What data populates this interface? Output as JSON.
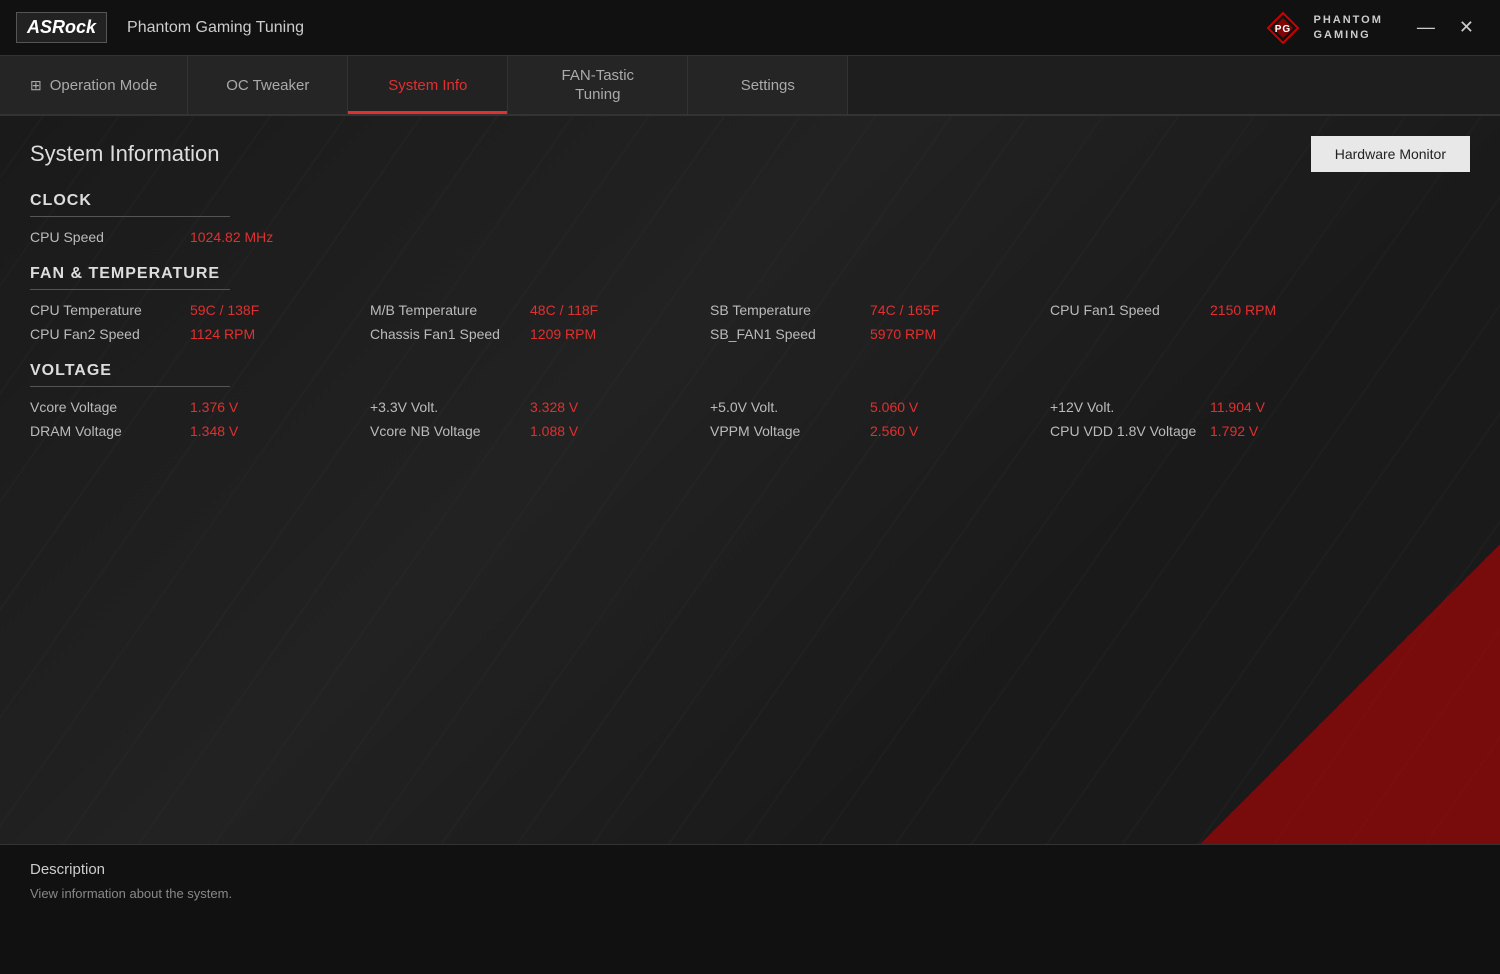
{
  "titlebar": {
    "logo": "ASRock",
    "app_title": "Phantom Gaming Tuning",
    "phantom_label": "PHANTOM\nGAMING",
    "minimize_label": "—",
    "close_label": "✕"
  },
  "nav": {
    "tabs": [
      {
        "id": "operation-mode",
        "label": "Operation Mode",
        "icon": "grid",
        "active": false
      },
      {
        "id": "oc-tweaker",
        "label": "OC Tweaker",
        "active": false
      },
      {
        "id": "system-info",
        "label": "System Info",
        "active": true
      },
      {
        "id": "fan-tastic",
        "label": "FAN-Tastic\nTuning",
        "active": false
      },
      {
        "id": "settings",
        "label": "Settings",
        "active": false
      }
    ]
  },
  "section": {
    "title": "System Information",
    "hardware_monitor_btn": "Hardware Monitor"
  },
  "clock": {
    "section_label": "CLOCK",
    "items": [
      {
        "label": "CPU Speed",
        "value": "1024.82 MHz"
      }
    ]
  },
  "fan_temperature": {
    "section_label": "FAN & TEMPERATURE",
    "rows": [
      [
        {
          "label": "CPU Temperature",
          "value": "59C / 138F"
        },
        {
          "label": "M/B Temperature",
          "value": "48C / 118F"
        },
        {
          "label": "SB Temperature",
          "value": "74C / 165F"
        },
        {
          "label": "CPU Fan1 Speed",
          "value": "2150 RPM"
        }
      ],
      [
        {
          "label": "CPU Fan2 Speed",
          "value": "1124 RPM"
        },
        {
          "label": "Chassis Fan1 Speed",
          "value": "1209 RPM"
        },
        {
          "label": "SB_FAN1 Speed",
          "value": "5970 RPM"
        }
      ]
    ]
  },
  "voltage": {
    "section_label": "VOLTAGE",
    "rows": [
      [
        {
          "label": "Vcore Voltage",
          "value": "1.376 V"
        },
        {
          "label": "+3.3V Volt.",
          "value": "3.328 V"
        },
        {
          "label": "+5.0V Volt.",
          "value": "5.060 V"
        },
        {
          "label": "+12V Volt.",
          "value": "11.904 V"
        }
      ],
      [
        {
          "label": "DRAM Voltage",
          "value": "1.348 V"
        },
        {
          "label": "Vcore NB Voltage",
          "value": "1.088 V"
        },
        {
          "label": "VPPM Voltage",
          "value": "2.560 V"
        },
        {
          "label": "CPU VDD 1.8V Voltage",
          "value": "1.792 V"
        }
      ]
    ]
  },
  "description": {
    "title": "Description",
    "text": "View information about the system."
  }
}
